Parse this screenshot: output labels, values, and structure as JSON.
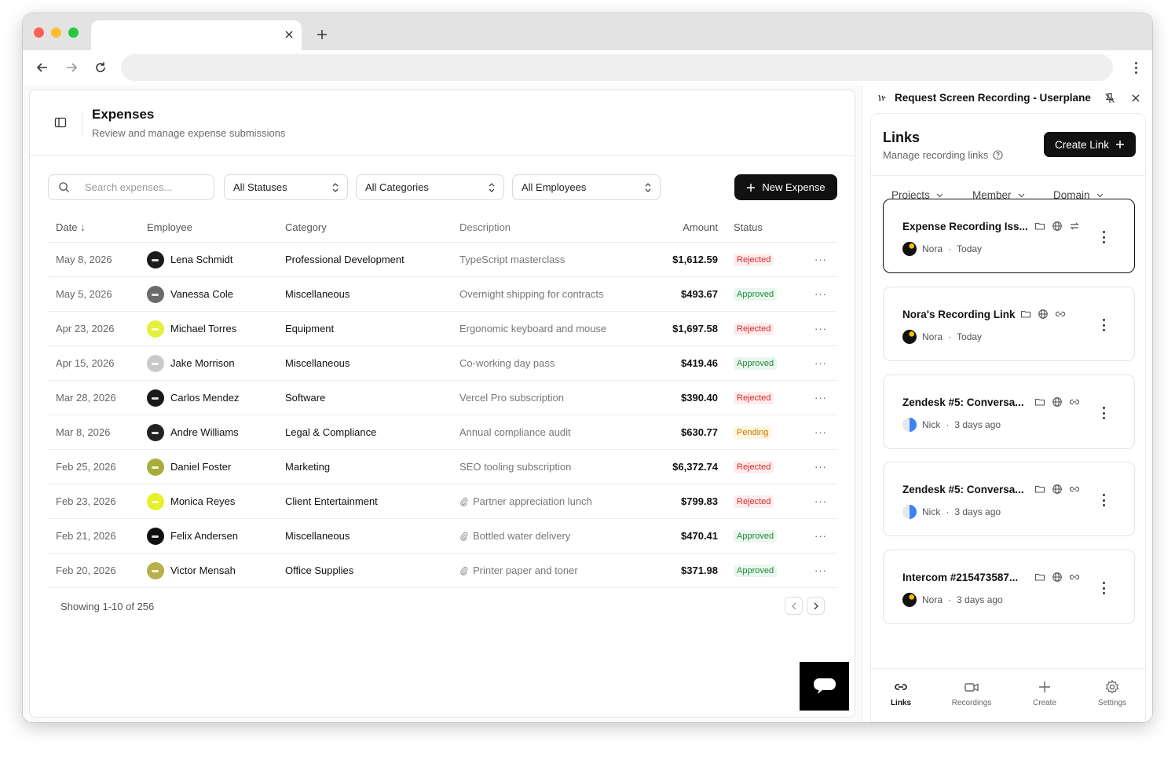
{
  "app": {
    "title": "Expenses",
    "subtitle": "Review and manage expense submissions"
  },
  "filters": {
    "search_placeholder": "Search expenses...",
    "status": "All Statuses",
    "category": "All Categories",
    "employee": "All Employees",
    "new_expense": "New Expense"
  },
  "table": {
    "headers": {
      "date": "Date",
      "employee": "Employee",
      "category": "Category",
      "description": "Description",
      "amount": "Amount",
      "status": "Status"
    },
    "rows": [
      {
        "date": "May 8, 2026",
        "employee": "Lena Schmidt",
        "avatar_color": "#1a1a1a",
        "category": "Professional Development",
        "description": "TypeScript masterclass",
        "attachment": false,
        "amount": "$1,612.59",
        "status": "Rejected"
      },
      {
        "date": "May 5, 2026",
        "employee": "Vanessa Cole",
        "avatar_color": "#6b6b6b",
        "category": "Miscellaneous",
        "description": "Overnight shipping for contracts",
        "attachment": false,
        "amount": "$493.67",
        "status": "Approved"
      },
      {
        "date": "Apr 23, 2026",
        "employee": "Michael Torres",
        "avatar_color": "#e4f03a",
        "category": "Equipment",
        "description": "Ergonomic keyboard and mouse",
        "attachment": false,
        "amount": "$1,697.58",
        "status": "Rejected"
      },
      {
        "date": "Apr 15, 2026",
        "employee": "Jake Morrison",
        "avatar_color": "#c9c9c9",
        "category": "Miscellaneous",
        "description": "Co-working day pass",
        "attachment": false,
        "amount": "$419.46",
        "status": "Approved"
      },
      {
        "date": "Mar 28, 2026",
        "employee": "Carlos Mendez",
        "avatar_color": "#1a1a1a",
        "category": "Software",
        "description": "Vercel Pro subscription",
        "attachment": false,
        "amount": "$390.40",
        "status": "Rejected"
      },
      {
        "date": "Mar 8, 2026",
        "employee": "Andre Williams",
        "avatar_color": "#222222",
        "category": "Legal & Compliance",
        "description": "Annual compliance audit",
        "attachment": false,
        "amount": "$630.77",
        "status": "Pending"
      },
      {
        "date": "Feb 25, 2026",
        "employee": "Daniel Foster",
        "avatar_color": "#a7ad3a",
        "category": "Marketing",
        "description": "SEO tooling subscription",
        "attachment": false,
        "amount": "$6,372.74",
        "status": "Rejected"
      },
      {
        "date": "Feb 23, 2026",
        "employee": "Monica Reyes",
        "avatar_color": "#e8f02a",
        "category": "Client Entertainment",
        "description": "Partner appreciation lunch",
        "attachment": true,
        "amount": "$799.83",
        "status": "Rejected"
      },
      {
        "date": "Feb 21, 2026",
        "employee": "Felix Andersen",
        "avatar_color": "#111111",
        "category": "Miscellaneous",
        "description": "Bottled water delivery",
        "attachment": true,
        "amount": "$470.41",
        "status": "Approved"
      },
      {
        "date": "Feb 20, 2026",
        "employee": "Victor Mensah",
        "avatar_color": "#b8b04a",
        "category": "Office Supplies",
        "description": "Printer paper and toner",
        "attachment": true,
        "amount": "$371.98",
        "status": "Approved"
      }
    ]
  },
  "pagination": {
    "summary": "Showing 1-10 of 256"
  },
  "extension": {
    "title": "Request Screen Recording - Userplane",
    "links_title": "Links",
    "links_subtitle": "Manage recording links",
    "create_link": "Create Link",
    "filters": [
      "Projects",
      "Member",
      "Domain"
    ],
    "recordings": [
      {
        "title": "Expense Recording Iss...",
        "user": "Nora",
        "when": "Today",
        "avatar": "nora",
        "selected": true,
        "third_icon": "sync"
      },
      {
        "title": "Nora's Recording Link",
        "user": "Nora",
        "when": "Today",
        "avatar": "nora",
        "selected": false,
        "third_icon": "link"
      },
      {
        "title": "Zendesk #5: Conversa...",
        "user": "Nick",
        "when": "3 days ago",
        "avatar": "nick",
        "selected": false,
        "third_icon": "link"
      },
      {
        "title": "Zendesk #5: Conversa...",
        "user": "Nick",
        "when": "3 days ago",
        "avatar": "nick",
        "selected": false,
        "third_icon": "link"
      },
      {
        "title": "Intercom #215473587...",
        "user": "Nora",
        "when": "3 days ago",
        "avatar": "nora",
        "selected": false,
        "third_icon": "link"
      }
    ],
    "nav": [
      "Links",
      "Recordings",
      "Create",
      "Settings"
    ],
    "active_nav": "Links"
  },
  "colors": {
    "rejected": "#d42a2a",
    "approved": "#1f8a3a",
    "pending": "#c77a00",
    "primary": "#111111"
  }
}
